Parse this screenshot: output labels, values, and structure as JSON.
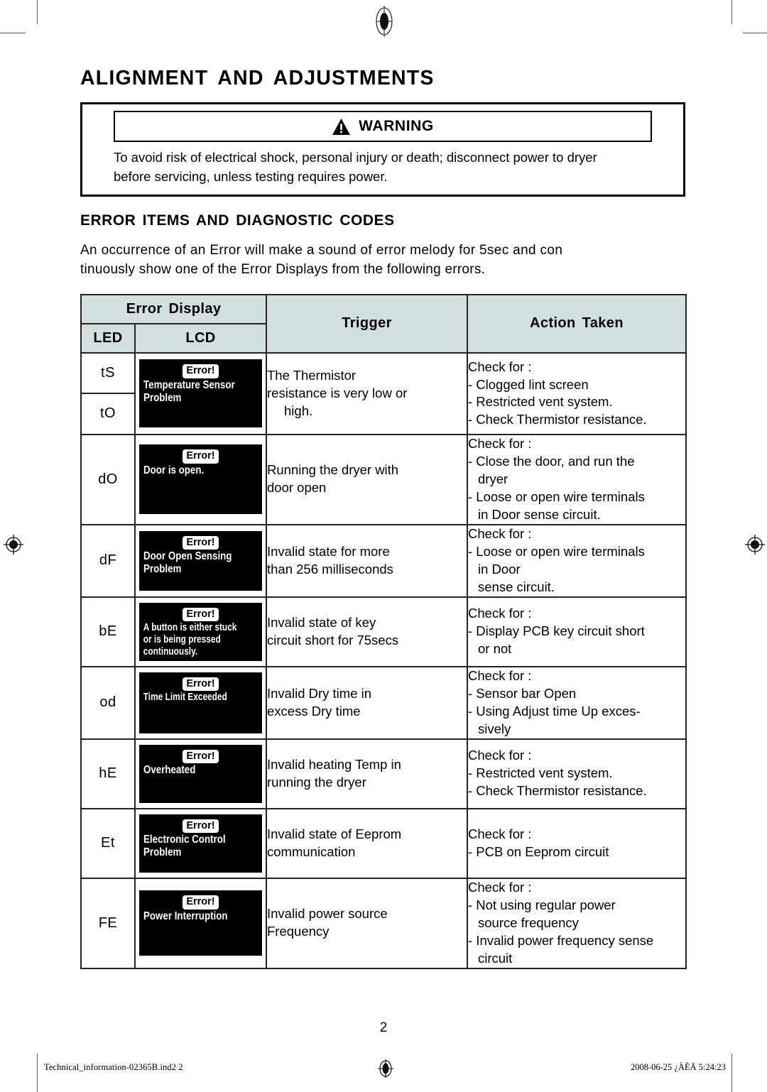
{
  "page_title": "ALIGNMENT AND ADJUSTMENTS",
  "warning": {
    "icon": "warning-triangle-icon",
    "label": "WARNING",
    "line1": "To avoid risk of electrical shock, personal injury or death; disconnect power to dryer",
    "line2": "before servicing, unless testing requires power."
  },
  "section": {
    "title": "ERROR ITEMS AND DIAGNOSTIC CODES",
    "intro_line1": "An occurrence of an Error will make a sound of error melody for 5sec and con",
    "intro_line2": "tinuously show one of the Error Displays from the following errors."
  },
  "table": {
    "headers": {
      "error_display": "Error Display",
      "led": "LED",
      "lcd": "LCD",
      "trigger": "Trigger",
      "action_taken": "Action Taken"
    },
    "rows": [
      {
        "led": [
          "tS",
          "tO"
        ],
        "lcd": {
          "badge": "Error!",
          "lines": [
            "Temperature Sensor",
            "Problem"
          ]
        },
        "trigger": [
          {
            "text": "The Thermistor",
            "indent": false
          },
          {
            "text": "resistance is very low or",
            "indent": false
          },
          {
            "text": "high.",
            "indent": true
          }
        ],
        "action": [
          {
            "text": "Check for :",
            "indent": false
          },
          {
            "text": "- Clogged lint screen",
            "indent": false
          },
          {
            "text": "- Restricted vent system.",
            "indent": false
          },
          {
            "text": "- Check Thermistor resistance.",
            "indent": false
          }
        ]
      },
      {
        "led": [
          "dO"
        ],
        "lcd": {
          "badge": "Error!",
          "lines": [
            "Door is open."
          ]
        },
        "trigger": [
          {
            "text": "Running the dryer with",
            "indent": false
          },
          {
            "text": "door open",
            "indent": false
          }
        ],
        "action": [
          {
            "text": "Check for :",
            "indent": false
          },
          {
            "text": "- Close the door, and run the",
            "indent": false
          },
          {
            "text": "dryer",
            "indent": true
          },
          {
            "text": "- Loose or open wire terminals",
            "indent": false
          },
          {
            "text": "in Door sense circuit.",
            "indent": true
          }
        ]
      },
      {
        "led": [
          "dF"
        ],
        "lcd": {
          "badge": "Error!",
          "lines": [
            "Door Open Sensing",
            "Problem"
          ]
        },
        "trigger": [
          {
            "text": "Invalid state for more",
            "indent": false
          },
          {
            "text": "than 256 milliseconds",
            "indent": false
          }
        ],
        "action": [
          {
            "text": "Check for :",
            "indent": false
          },
          {
            "text": "- Loose or open wire terminals",
            "indent": false
          },
          {
            "text": "in Door",
            "indent": true
          },
          {
            "text": "sense circuit.",
            "indent": true
          }
        ]
      },
      {
        "led": [
          "bE"
        ],
        "lcd": {
          "badge": "Error!",
          "lines": [
            "A button is either stuck",
            "or is being pressed",
            "continuously."
          ],
          "tight": true
        },
        "trigger": [
          {
            "text": "Invalid state of key",
            "indent": false
          },
          {
            "text": "circuit short for 75secs",
            "indent": false
          }
        ],
        "action": [
          {
            "text": "Check for :",
            "indent": false
          },
          {
            "text": "- Display PCB key circuit short",
            "indent": false
          },
          {
            "text": "or not",
            "indent": true
          }
        ]
      },
      {
        "led": [
          "od"
        ],
        "lcd": {
          "badge": "Error!",
          "lines": [
            "Time Limit Exceeded"
          ],
          "tight": true
        },
        "trigger": [
          {
            "text": "Invalid Dry time in",
            "indent": false
          },
          {
            "text": "excess Dry time",
            "indent": false
          }
        ],
        "action": [
          {
            "text": "Check for :",
            "indent": false
          },
          {
            "text": "- Sensor bar Open",
            "indent": false
          },
          {
            "text": "- Using Adjust time Up exces-",
            "indent": false
          },
          {
            "text": "sively",
            "indent": true
          }
        ]
      },
      {
        "led": [
          "hE"
        ],
        "lcd": {
          "badge": "Error!",
          "lines": [
            "Overheated"
          ]
        },
        "trigger": [
          {
            "text": "Invalid heating Temp in",
            "indent": false
          },
          {
            "text": "running the dryer",
            "indent": false
          }
        ],
        "action": [
          {
            "text": "Check for :",
            "indent": false
          },
          {
            "text": "- Restricted vent system.",
            "indent": false
          },
          {
            "text": "- Check Thermistor resistance.",
            "indent": false
          }
        ]
      },
      {
        "led": [
          "Et"
        ],
        "lcd": {
          "badge": "Error!",
          "lines": [
            "Electronic Control",
            "Problem"
          ]
        },
        "trigger": [
          {
            "text": "Invalid state of Eeprom",
            "indent": false
          },
          {
            "text": "communication",
            "indent": false
          }
        ],
        "action": [
          {
            "text": "Check for :",
            "indent": false
          },
          {
            "text": "- PCB on Eeprom circuit",
            "indent": false
          }
        ]
      },
      {
        "led": [
          "FE"
        ],
        "lcd": {
          "badge": "Error!",
          "lines": [
            "Power Interruption"
          ]
        },
        "trigger": [
          {
            "text": "Invalid power source",
            "indent": false
          },
          {
            "text": "Frequency",
            "indent": false
          }
        ],
        "action": [
          {
            "text": "Check for :",
            "indent": false
          },
          {
            "text": "- Not using regular power",
            "indent": false
          },
          {
            "text": "source frequency",
            "indent": true
          },
          {
            "text": "- Invalid power frequency sense",
            "indent": false
          },
          {
            "text": "circuit",
            "indent": true
          }
        ]
      }
    ]
  },
  "page_number": "2",
  "footer": {
    "left": "Technical_information-02365B.ind2   2",
    "right": "2008-06-25   ¿ÀÈÄ 5:24:23"
  },
  "colors": {
    "header_fill": "#d3dfdf",
    "rule": "#2a2020",
    "lcd_background": "#000000"
  }
}
